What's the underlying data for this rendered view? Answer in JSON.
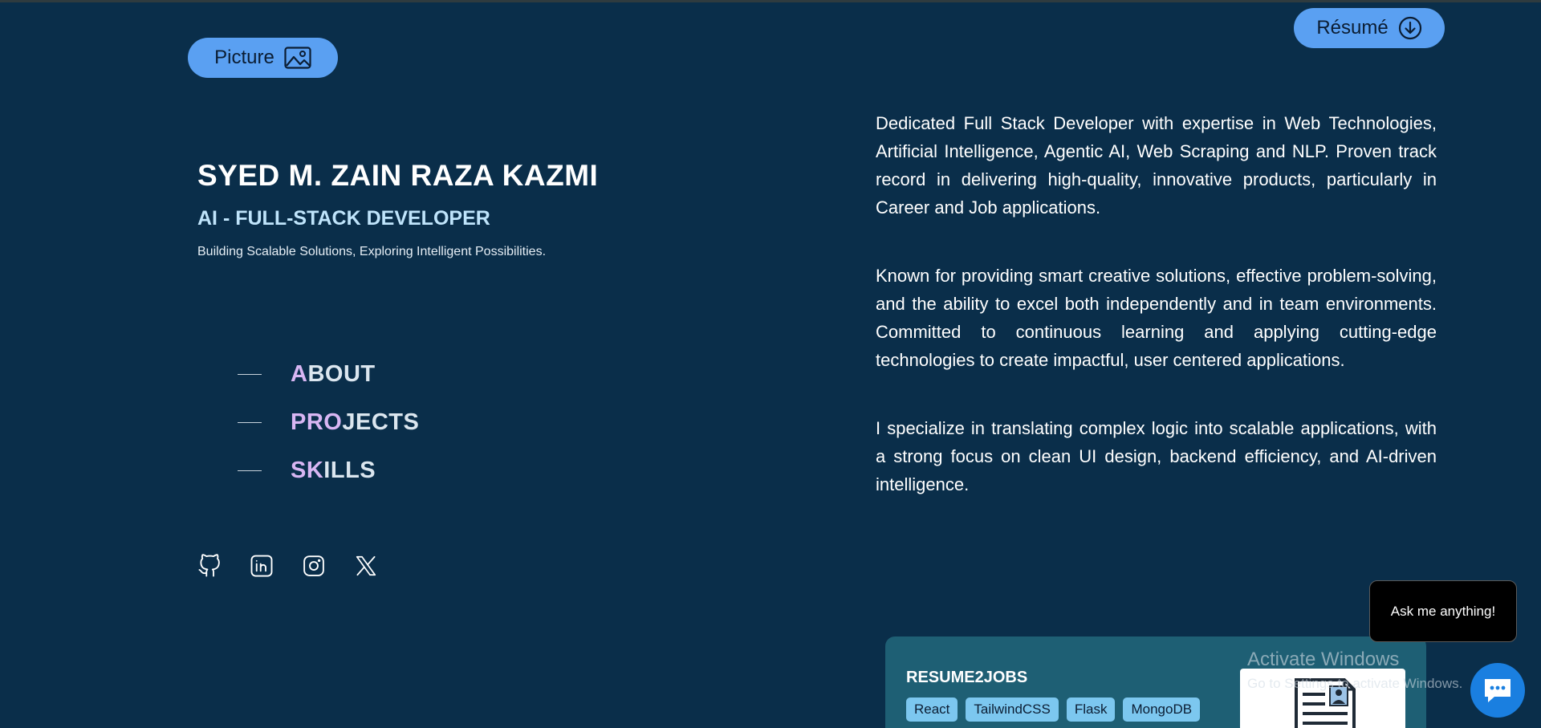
{
  "header": {
    "picture_label": "Picture",
    "picture_icon": "image-icon",
    "resume_label": "Résumé",
    "resume_icon": "download-circle-icon",
    "accent_color": "#5aa0f2"
  },
  "hero": {
    "name": "SYED M. ZAIN RAZA KAZMI",
    "role": "AI - FULL-STACK DEVELOPER",
    "tagline": "Building Scalable Solutions, Exploring Intelligent Possibilities."
  },
  "nav": {
    "items": [
      {
        "highlight": "A",
        "rest": "BOUT"
      },
      {
        "highlight": "PRO",
        "rest": "JECTS"
      },
      {
        "highlight": "SK",
        "rest": "ILLS"
      }
    ]
  },
  "socials": [
    "github-icon",
    "linkedin-icon",
    "instagram-icon",
    "x-twitter-icon"
  ],
  "bio": {
    "paragraphs": [
      "Dedicated Full Stack Developer with expertise in Web Technologies, Artificial Intelligence, Agentic AI, Web Scraping and NLP. Proven track record in delivering high-quality, innovative products, particularly in Career and Job applications.",
      "Known for providing smart creative solutions, effective problem-solving, and the ability to excel both independently and in team environments. Committed to continuous learning and applying cutting-edge technologies to create impactful, user centered applications.",
      "I specialize in translating complex logic into scalable applications, with a strong focus on clean UI design, backend efficiency, and AI-driven intelligence."
    ]
  },
  "project": {
    "title": "RESUME2JOBS",
    "tags": [
      "React",
      "TailwindCSS",
      "Flask",
      "MongoDB"
    ]
  },
  "watermark": {
    "title": "Activate Windows",
    "subtitle": "Go to Settings to activate Windows."
  },
  "chat": {
    "bubble_text": "Ask me anything!",
    "fab_icon": "chat-icon"
  },
  "colors": {
    "background": "#0a2e4a",
    "nav_highlight": "#d8b6f3",
    "role_text": "#bfe4fb",
    "card": "#1e5f74",
    "tag": "#7cc7ef"
  }
}
